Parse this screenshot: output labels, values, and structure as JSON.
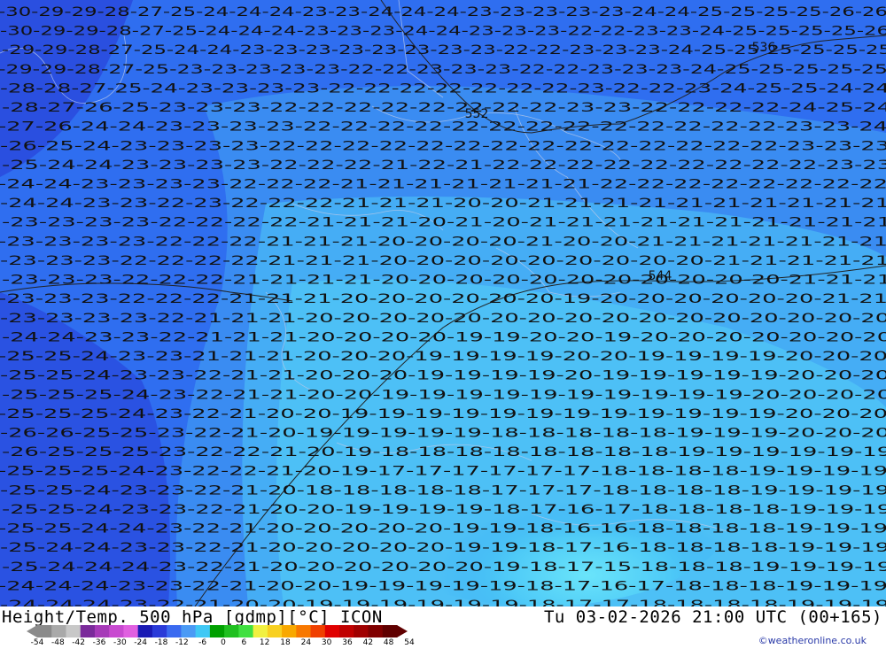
{
  "title_left": "Height/Temp. 500 hPa [gdmp][°C] ICON",
  "title_right": "Tu 03-02-2026 21:00 UTC (00+165)",
  "credit": "©weatheronline.co.uk",
  "legend": {
    "ticks": [
      "-54",
      "-48",
      "-42",
      "-36",
      "-30",
      "-24",
      "-18",
      "-12",
      "-6",
      "0",
      "6",
      "12",
      "18",
      "24",
      "30",
      "36",
      "42",
      "48",
      "54"
    ],
    "colors": [
      "#8a8a8a",
      "#a9a9a9",
      "#c8c8c8",
      "#7a2a9a",
      "#a63ab8",
      "#c84ad0",
      "#e060e0",
      "#1a1ab4",
      "#2a3ad8",
      "#3a6af0",
      "#4a9af5",
      "#40c8f5",
      "#00a000",
      "#20c020",
      "#40e040",
      "#f0f040",
      "#f8d020",
      "#f8a800",
      "#f87800",
      "#f04000",
      "#e00000",
      "#c00000",
      "#a00000",
      "#800000",
      "#600000"
    ]
  },
  "map_labels": [
    {
      "value": "544",
      "region": "east-central"
    },
    {
      "value": "552",
      "region": "north-center"
    },
    {
      "value": "536",
      "region": "north-east"
    }
  ],
  "temps": {
    "rows": [
      "-30-29-29-28-27-25-24-24-24-23-23-24-24-24-23-23-23-23-23-24-24-25-25-25-25-26-26",
      "-30-29-29-28-27-25-24-24-24-23-23-23-24-24-23-23-23-22-22-23-23-24-25-25-25-25-26",
      "-29-29-28-27-25-24-24-23-23-23-23-23-23-23-23-22-22-23-23-23-24-25-25-25-25-25-25",
      "-29-29-28-27-25-23-23-23-23-23-22-22-23-23-23-22-22-23-23-23-24-25-25-25-25-25",
      "-28-28-27-25-24-23-23-23-23-22-22-22-22-22-22-22-23-22-22-23-24-25-25-24-24",
      "-28-27-26-25-23-23-23-22-22-22-22-22-22-22-22-23-23-22-22-22-22-24-25-24",
      "-27-26-24-24-23-23-23-23-22-22-22-22-22-22-22-22-22-22-22-22-22-23-23-24",
      "-26-25-24-23-23-23-23-22-22-22-22-22-22-22-22-22-22-22-22-22-22-23-23-23",
      "-25-24-24-23-23-23-23-22-22-22-21-22-21-22-22-22-22-22-22-22-22-22-23-23",
      "-24-24-23-23-23-23-22-22-22-21-21-21-21-21-21-21-22-22-22-22-22-22-22-22",
      "-24-24-23-23-22-23-22-22-22-21-21-21-20-20-21-21-21-21-21-21-21-21-21-21",
      "-23-23-23-23-22-22-22-22-21-21-21-20-21-20-21-21-21-21-21-21-21-21-21-21",
      "-23-23-23-23-22-22-22-21-21-21-20-20-20-20-21-20-20-21-21-21-21-21-21-21",
      "-23-23-23-22-22-22-22-21-21-21-20-20-20-20-20-20-20-20-20-21-21-21-21-21",
      "-23-23-23-22-22-22-21-21-21-21-20-20-20-20-20-20-20-20-20-20-20-21-21-21",
      "-23-23-23-22-22-22-21-21-21-20-20-20-20-20-20-19-20-20-20-20-20-20-21-21",
      "-23-23-23-23-22-21-21-21-20-20-20-20-20-20-20-20-20-20-20-20-20-20-20-20",
      "-24-24-23-23-22-21-21-21-20-20-20-20-19-19-20-20-19-20-20-20-20-20-20-20",
      "-25-25-24-23-23-21-21-21-20-20-20-19-19-19-19-20-20-19-19-19-19-20-20-20",
      "-25-25-24-23-23-22-21-21-20-20-20-19-19-19-19-20-19-19-19-19-19-20-20-20",
      "-25-25-25-24-23-22-21-21-20-20-19-19-19-19-19-19-19-19-19-19-20-20-20-20",
      "-25-25-25-24-23-22-21-20-20-19-19-19-19-19-19-19-19-19-19-19-19-20-20-20",
      "-26-26-25-25-23-22-21-20-19-19-19-19-19-18-18-18-18-18-19-19-19-20-20-20",
      "-26-25-25-25-23-22-22-21-20-19-18-18-18-18-18-18-18-18-19-19-19-19-19-19",
      "-25-25-25-24-23-22-22-21-20-19-17-17-17-17-17-17-18-18-18-18-19-19-19-19",
      "-25-25-24-23-23-22-21-20-18-18-18-18-18-17-17-17-18-18-18-18-19-19-19-19",
      "-25-25-24-23-23-22-21-20-20-19-19-19-19-18-17-16-17-18-18-18-18-19-19-19",
      "-25-25-24-24-23-22-21-20-20-20-20-20-19-19-18-16-16-18-18-18-18-19-19-19",
      "-25-24-24-23-23-22-21-20-20-20-20-20-19-19-18-17-16-18-18-18-18-19-19-19",
      "-25-24-24-24-23-22-21-20-20-20-20-20-20-19-18-17-15-18-18-18-19-19-19-19",
      "-24-24-24-23-23-22-21-20-20-19-19-19-19-19-18-17-16-17-18-18-18-19-19-19",
      "-24-24-24-23-22-21-20-20-19-19-19-19-19-19-18-17-17-18-18-18-18-19-19-19"
    ]
  }
}
